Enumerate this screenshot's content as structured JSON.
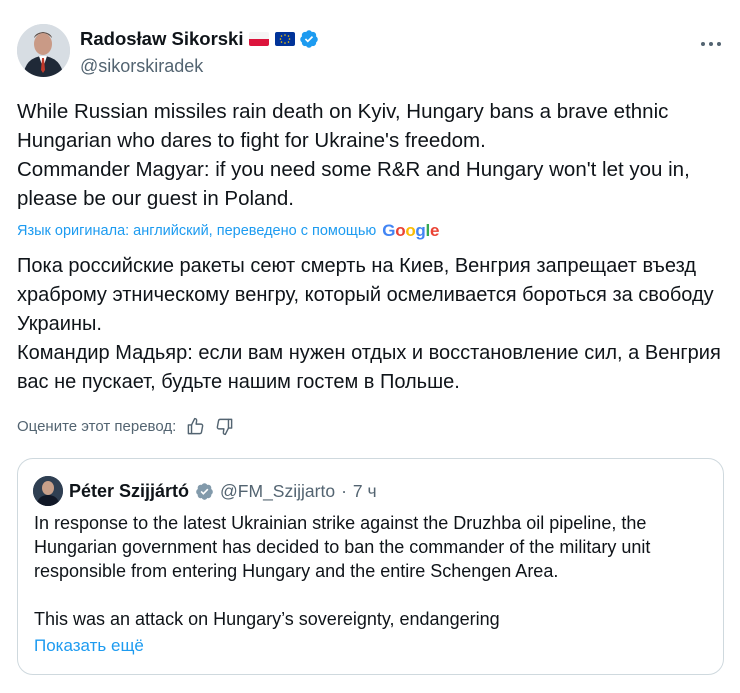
{
  "tweet": {
    "author": {
      "name": "Radosław Sikorski",
      "handle": "@sikorskiradek",
      "flags": [
        "flag-poland-icon",
        "flag-eu-icon"
      ],
      "verified": true
    },
    "more_icon": "more-horizontal-icon",
    "text_lines": [
      "While Russian missiles rain death on Kyiv, Hungary bans a brave ethnic Hungarian who dares to fight for Ukraine's freedom.",
      "Commander Magyar: if you need some R&R and Hungary won't let you in, please be our guest in Poland."
    ],
    "translation": {
      "note": "Язык оригинала: английский, переведено с помощью",
      "provider": "Google",
      "lines": [
        "Пока российские ракеты сеют смерть на Киев, Венгрия запрещает въезд храброму этническому венгру, который осмеливается бороться за свободу Украины.",
        "Командир Мадьяр: если вам нужен отдых и восстановление сил, а Венгрия вас не пускает, будьте нашим гостем в Польше."
      ],
      "rate_label": "Оцените этот перевод:"
    }
  },
  "quote": {
    "author": {
      "name": "Péter Szijjártó",
      "handle": "@FM_Szijjarto",
      "separator": "·",
      "time": "7 ч",
      "verified_badge": "gray"
    },
    "paragraph_1": "In response to the latest Ukrainian strike against the Druzhba oil pipeline, the Hungarian government has decided to ban the commander of the military unit responsible from entering Hungary and the entire Schengen Area.",
    "paragraph_2": "This was an attack on Hungary’s sovereignty, endangering",
    "show_more": "Показать ещё"
  },
  "colors": {
    "link": "#1d9bf0",
    "secondary_text": "#536471",
    "border": "#cfd9de",
    "verified_blue": "#1d9bf0",
    "verified_gray": "#829aab"
  }
}
